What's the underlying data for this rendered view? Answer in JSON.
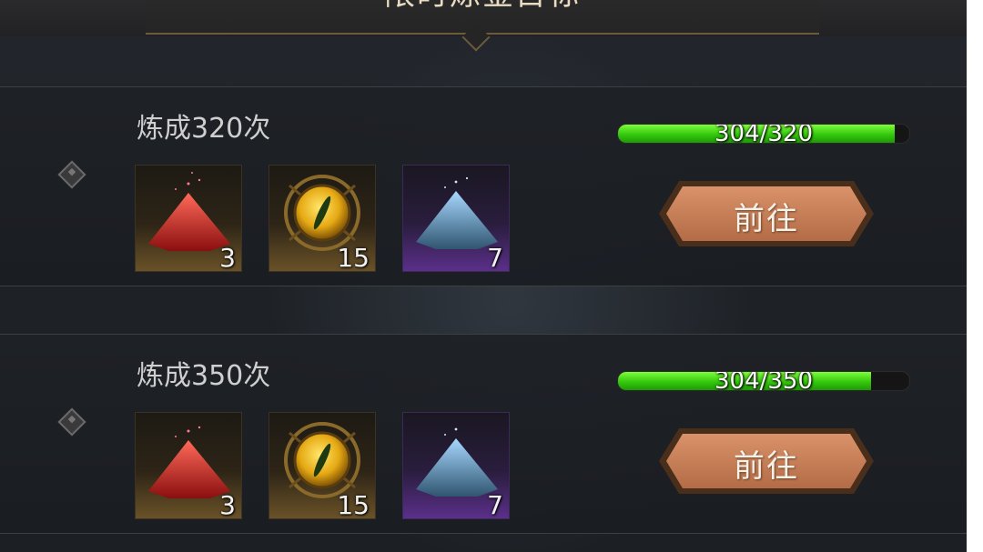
{
  "header": {
    "title": "限时炼金目标"
  },
  "rows": [
    {
      "title": "炼成320次",
      "items": [
        {
          "icon": "red-powder-icon",
          "count": "3"
        },
        {
          "icon": "golden-eye-icon",
          "count": "15"
        },
        {
          "icon": "blue-powder-icon",
          "count": "7"
        }
      ],
      "progress": {
        "text": "304/320",
        "current": 304,
        "target": 320
      },
      "button": "前往"
    },
    {
      "title": "炼成350次",
      "items": [
        {
          "icon": "red-powder-icon",
          "count": "3"
        },
        {
          "icon": "golden-eye-icon",
          "count": "15"
        },
        {
          "icon": "blue-powder-icon",
          "count": "7"
        }
      ],
      "progress": {
        "text": "304/350",
        "current": 304,
        "target": 350
      },
      "button": "前往"
    }
  ],
  "colors": {
    "progress_fill": "#3ccc12",
    "button": "#c9825a",
    "accent_gold": "#6b5a3c"
  }
}
